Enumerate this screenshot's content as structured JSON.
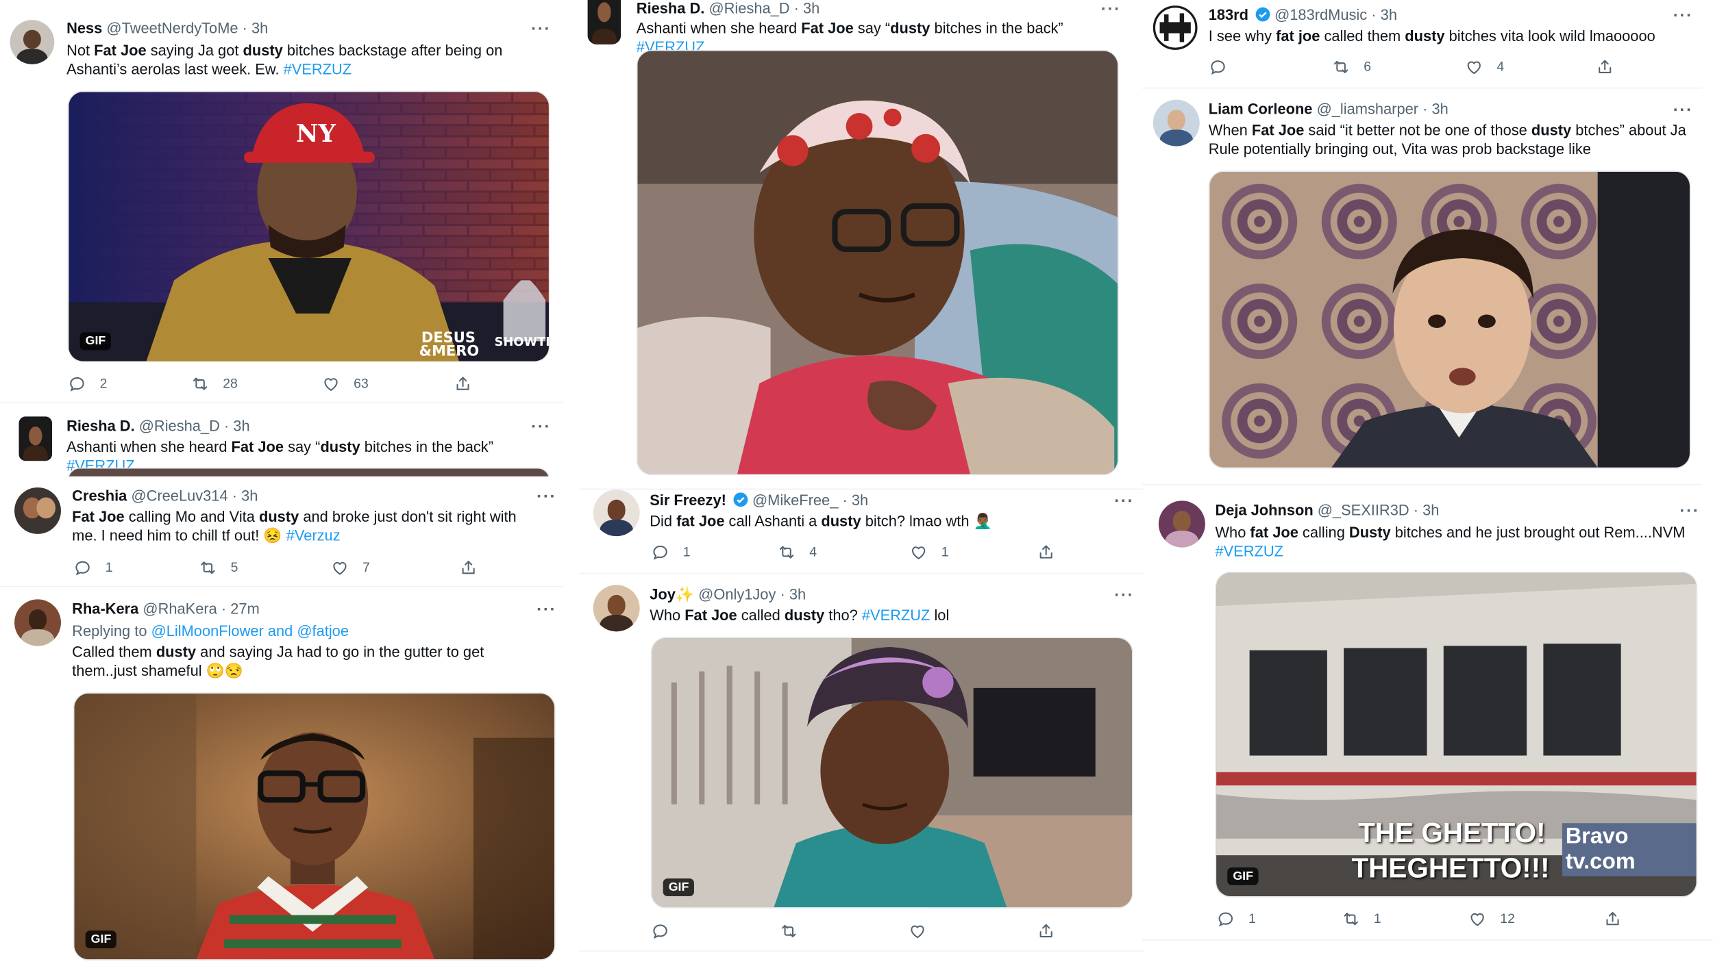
{
  "tweets": [
    {
      "name": "Ness",
      "handle": "@TweetNerdyToMe",
      "time": "3h",
      "reply_to": "",
      "reply_users": "",
      "segments": [
        [
          "Not ",
          0
        ],
        [
          "Fat Joe",
          1
        ],
        [
          " saying Ja got ",
          0
        ],
        [
          "dusty",
          1
        ],
        [
          " bitches backstage after being on Ashanti’s aerolas last week. Ew. ",
          0
        ],
        [
          "#VERZUZ",
          2
        ]
      ],
      "counts": [
        "2",
        "28",
        "63"
      ],
      "gif_label": "GIF",
      "media_caption": "DESUS & MERO · SHOWTIME"
    },
    {
      "name": "Riesha D.",
      "handle": "@Riesha_D",
      "time": "3h",
      "reply_to": "",
      "reply_users": "",
      "segments": [
        [
          "Ashanti when she heard ",
          0
        ],
        [
          "Fat Joe",
          1
        ],
        [
          " say “",
          0
        ],
        [
          "dusty",
          1
        ],
        [
          " bitches in the back” ",
          0
        ],
        [
          "#VERZUZ",
          2
        ]
      ],
      "counts": [
        "",
        "",
        ""
      ],
      "gif_label": "",
      "media_caption": ""
    },
    {
      "name": "Creshia",
      "handle": "@CreeLuv314",
      "time": "3h",
      "reply_to": "",
      "reply_users": "",
      "segments": [
        [
          "Fat Joe",
          1
        ],
        [
          " calling Mo and Vita ",
          0
        ],
        [
          "dusty",
          1
        ],
        [
          " and broke just don't sit right with me. I need him to chill tf out! 😣 ",
          0
        ],
        [
          "#Verzuz",
          2
        ]
      ],
      "counts": [
        "1",
        "5",
        "7"
      ],
      "gif_label": "",
      "media_caption": ""
    },
    {
      "name": "Rha-Kera",
      "handle": "@RhaKera",
      "time": "27m",
      "reply_to": "Replying to",
      "reply_users": "@LilMoonFlower and @fatjoe",
      "segments": [
        [
          "Called them ",
          0
        ],
        [
          "dusty",
          1
        ],
        [
          " and saying Ja had to go in the gutter to get them..just shameful 🙄😒",
          0
        ]
      ],
      "counts": [
        "",
        "",
        ""
      ],
      "gif_label": "GIF",
      "media_caption": ""
    },
    {
      "name": "Riesha D.",
      "handle": "@Riesha_D",
      "time": "3h",
      "reply_to": "",
      "reply_users": "",
      "segments": [
        [
          "Ashanti when she heard ",
          0
        ],
        [
          "Fat Joe",
          1
        ],
        [
          " say “",
          0
        ],
        [
          "dusty",
          1
        ],
        [
          " bitches in the back” ",
          0
        ],
        [
          "#VERZUZ",
          2
        ]
      ],
      "counts": [
        "",
        "",
        ""
      ],
      "gif_label": "",
      "media_caption": ""
    },
    {
      "name": "Sir Freezy!",
      "handle": "@MikeFree_",
      "time": "3h",
      "reply_to": "",
      "reply_users": "",
      "segments": [
        [
          "Did ",
          0
        ],
        [
          "fat Joe",
          1
        ],
        [
          " call Ashanti a ",
          0
        ],
        [
          "dusty",
          1
        ],
        [
          " bitch? lmao wth 🤦🏾‍♂️",
          0
        ]
      ],
      "counts": [
        "1",
        "4",
        "1"
      ],
      "gif_label": "",
      "media_caption": ""
    },
    {
      "name": "Joy✨",
      "handle": "@Only1Joy",
      "time": "3h",
      "reply_to": "",
      "reply_users": "",
      "segments": [
        [
          "Who ",
          0
        ],
        [
          "Fat Joe",
          1
        ],
        [
          " called ",
          0
        ],
        [
          "dusty",
          1
        ],
        [
          " tho? ",
          0
        ],
        [
          "#VERZUZ",
          2
        ],
        [
          " lol",
          0
        ]
      ],
      "counts": [
        "",
        "",
        ""
      ],
      "gif_label": "GIF",
      "media_caption": ""
    },
    {
      "name": "183rd",
      "handle": "@183rdMusic",
      "time": "3h",
      "reply_to": "",
      "reply_users": "",
      "segments": [
        [
          "I see why ",
          0
        ],
        [
          "fat joe",
          1
        ],
        [
          " called them ",
          0
        ],
        [
          "dusty",
          1
        ],
        [
          " bitches vita look wild lmaooooo",
          0
        ]
      ],
      "counts": [
        "",
        "6",
        "4"
      ],
      "gif_label": "",
      "media_caption": ""
    },
    {
      "name": "Liam Corleone",
      "handle": "@_liamsharper",
      "time": "3h",
      "reply_to": "",
      "reply_users": "",
      "segments": [
        [
          "When ",
          0
        ],
        [
          "Fat Joe",
          1
        ],
        [
          " said “it better not be one of those ",
          0
        ],
        [
          "dusty",
          1
        ],
        [
          " btches” about Ja Rule potentially bringing out, Vita was prob backstage like",
          0
        ]
      ],
      "counts": [
        "",
        "",
        ""
      ],
      "gif_label": "",
      "media_caption": ""
    },
    {
      "name": "Deja Johnson",
      "handle": "@_SEXIIR3D",
      "time": "3h",
      "reply_to": "",
      "reply_users": "",
      "segments": [
        [
          "Who ",
          0
        ],
        [
          "fat Joe",
          1
        ],
        [
          " calling ",
          0
        ],
        [
          "Dusty",
          1
        ],
        [
          " bitches and he just brought out Rem....NVM ",
          0
        ],
        [
          "#VERZUZ",
          2
        ]
      ],
      "counts": [
        "1",
        "1",
        "12"
      ],
      "gif_label": "GIF",
      "media_caption": "THE GHETTO! THEGHETTO!!!"
    }
  ],
  "media_overlays": {
    "desus_logo": "DESUS & MERO",
    "network": "SHOWTIME",
    "bravo_caption_1": "THE GHETTO!",
    "bravo_caption_2": "THEGHETTO!!!",
    "bravo_watermark": "Bravo tv.com",
    "cap_logo": "NY"
  }
}
